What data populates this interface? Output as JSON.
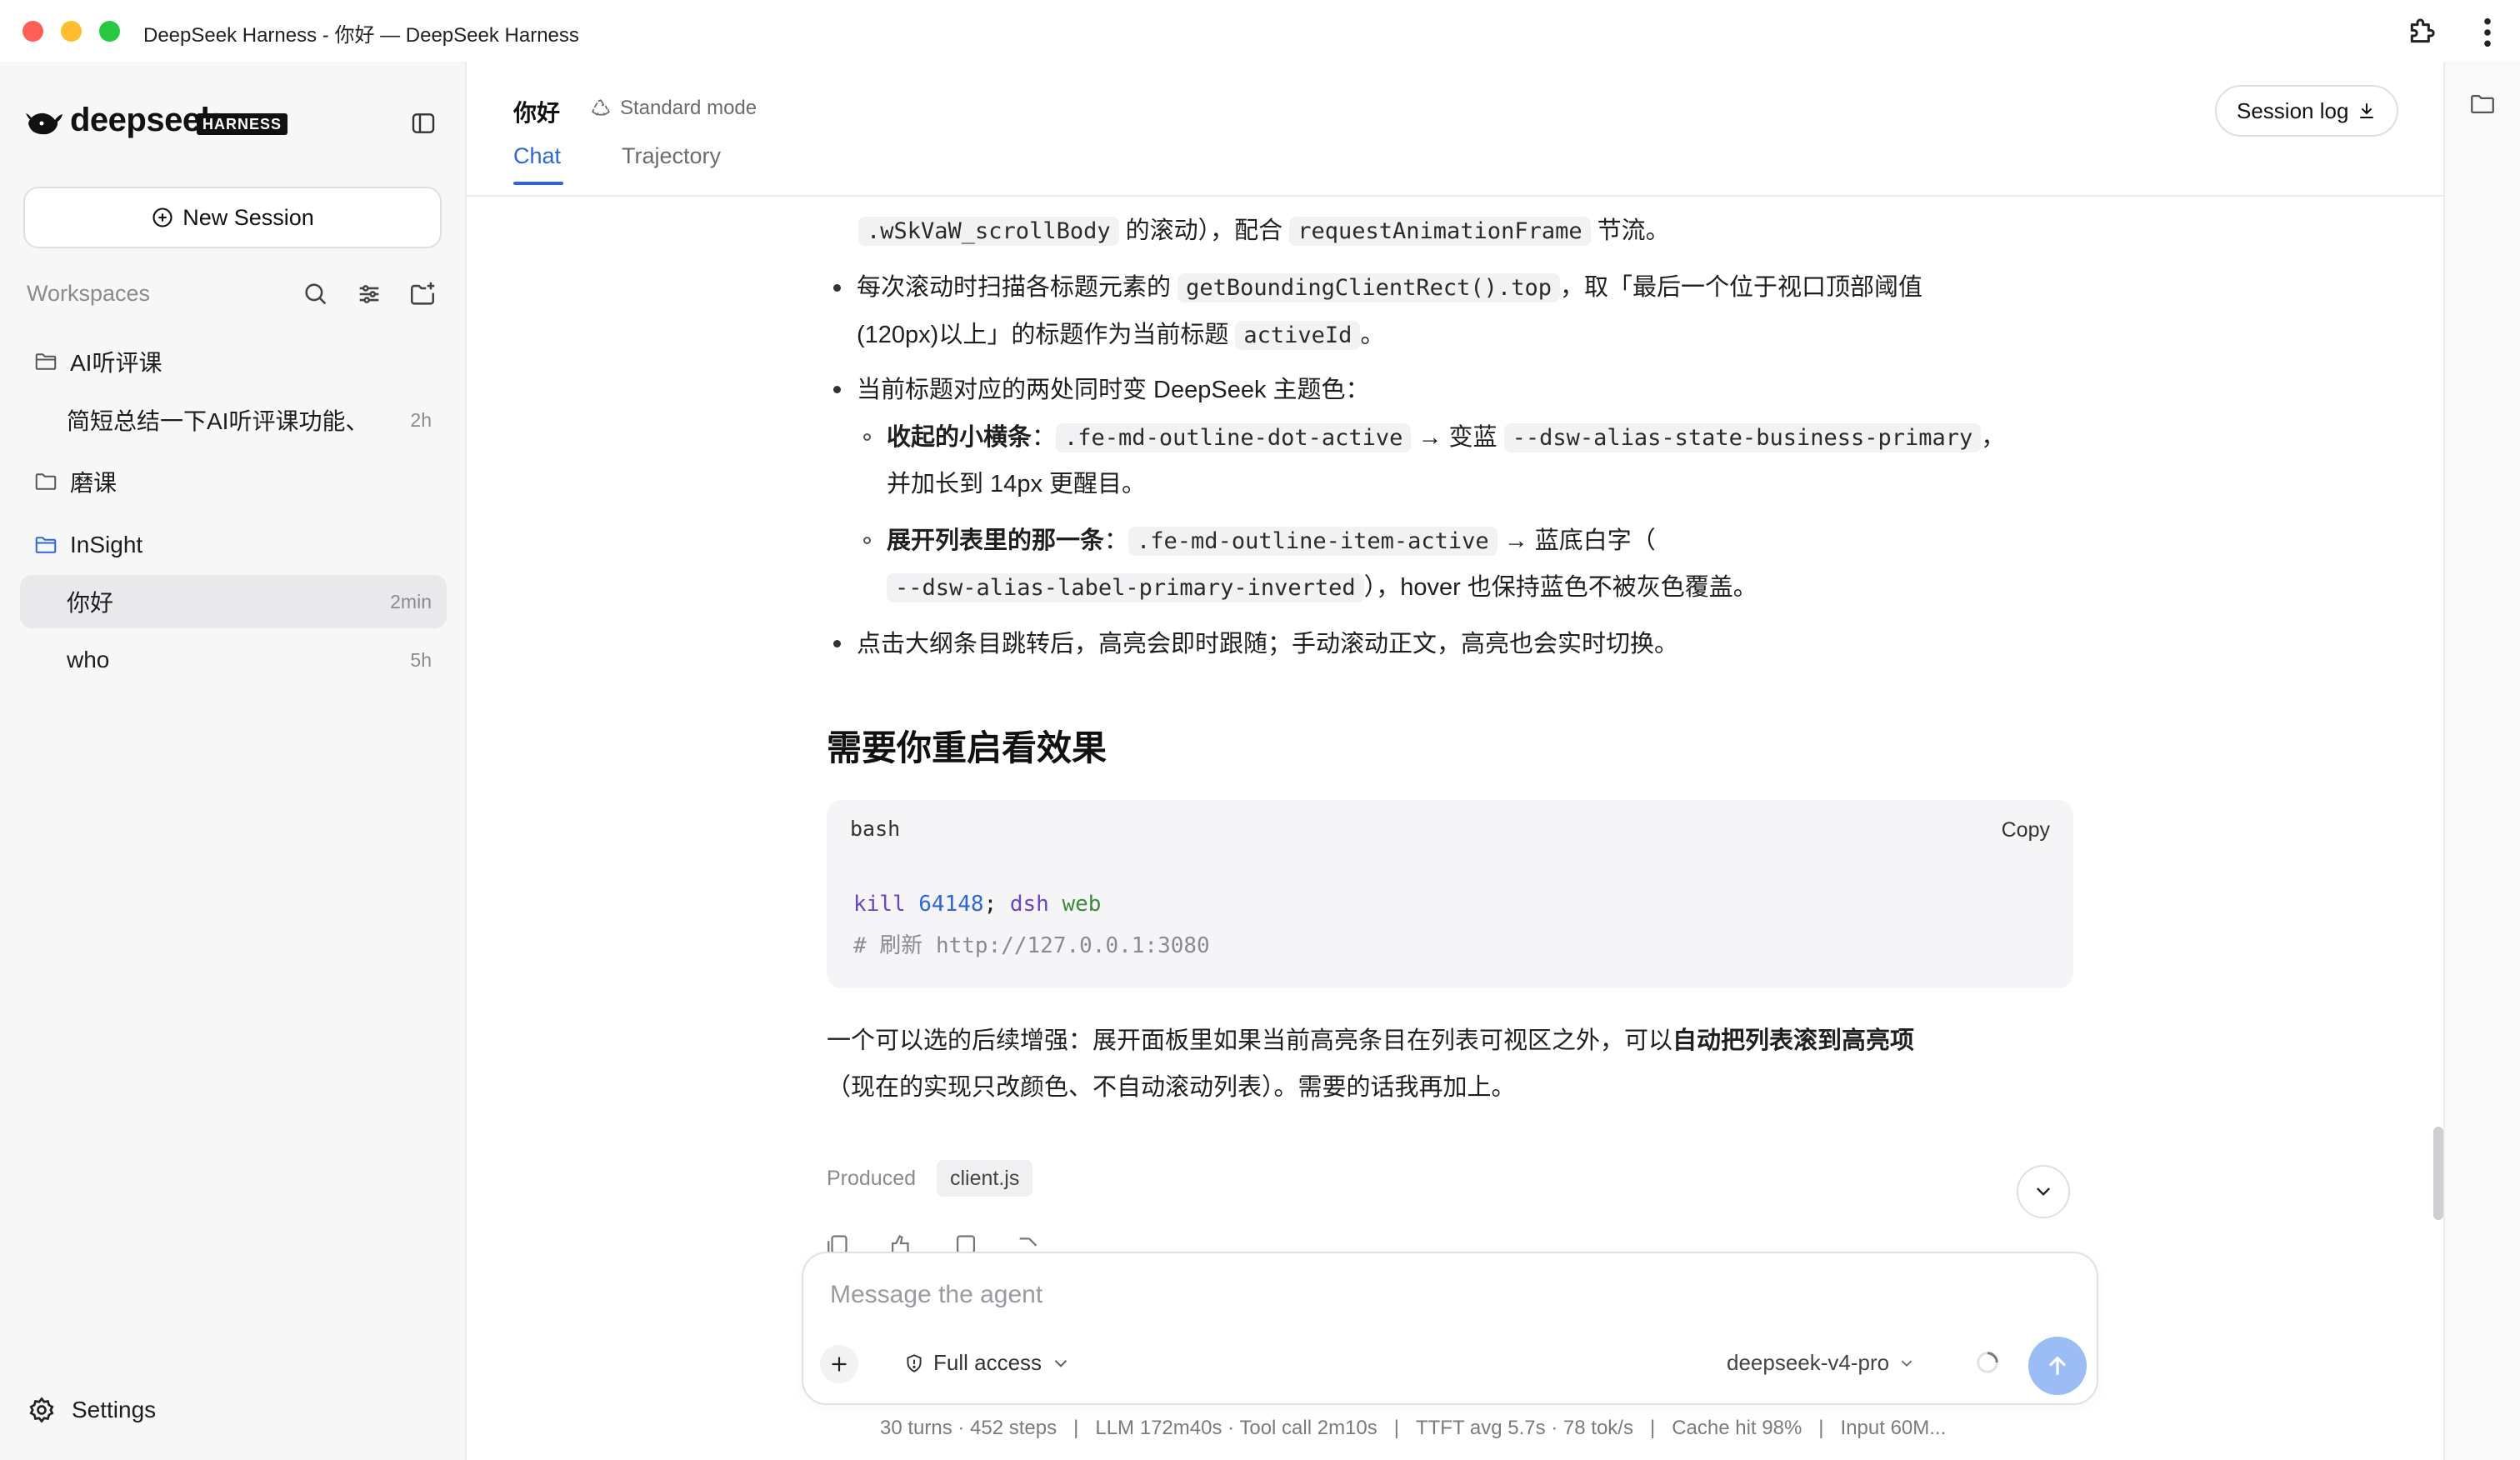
{
  "window": {
    "title": "DeepSeek Harness - 你好 — DeepSeek Harness"
  },
  "sidebar": {
    "logo_text": "deepseek",
    "logo_badge": "HARNESS",
    "new_session_label": "New Session",
    "workspaces_label": "Workspaces",
    "groups": [
      {
        "name": "AI听评课",
        "sessions": [
          {
            "title": "简短总结一下AI听评课功能、",
            "time": "2h"
          }
        ]
      },
      {
        "name": "磨课",
        "sessions": []
      },
      {
        "name": "InSight",
        "sessions": [
          {
            "title": "你好",
            "time": "2min",
            "active": true
          },
          {
            "title": "who",
            "time": "5h"
          }
        ]
      }
    ],
    "settings_label": "Settings"
  },
  "header": {
    "session_title": "你好",
    "mode_label": "Standard mode",
    "tabs": [
      {
        "label": "Chat",
        "active": true
      },
      {
        "label": "Trajectory"
      }
    ],
    "session_log_label": "Session log"
  },
  "message": {
    "l1_code_a": ".wSkVaW_scrollBody",
    "l1_text_a": " 的滚动），配合 ",
    "l1_code_b": "requestAnimationFrame",
    "l1_text_b": " 节流。",
    "b1_text_a": "每次滚动时扫描各标题元素的 ",
    "b1_code_a": "getBoundingClientRect().top",
    "b1_text_b": "，取「最后一个位于视口顶部阈值",
    "b1_text_c": "(120px)以上」的标题作为当前标题 ",
    "b1_code_b": "activeId",
    "b1_text_d": "。",
    "b2_text": "当前标题对应的两处同时变 DeepSeek 主题色：",
    "s1_bold": "收起的小横条",
    "s1_text_a": "：",
    "s1_code_a": ".fe-md-outline-dot-active",
    "s1_text_b": " → 变蓝 ",
    "s1_code_b": "--dsw-alias-state-business-primary",
    "s1_text_c": "，",
    "s1_text_d": "并加长到 14px 更醒目。",
    "s2_bold": "展开列表里的那一条",
    "s2_text_a": "：",
    "s2_code_a": ".fe-md-outline-item-active",
    "s2_text_b": " → 蓝底白字（",
    "s2_code_b": "--dsw-alias-label-primary-inverted",
    "s2_text_c": "），hover 也保持蓝色不被灰色覆盖。",
    "b3_text": "点击大纲条目跳转后，高亮会即时跟随；手动滚动正文，高亮也会实时切换。",
    "heading": "需要你重启看效果",
    "code_lang": "bash",
    "copy_label": "Copy",
    "code_l1_kw1": "kill",
    "code_l1_num": "64148",
    "code_l1_semi": ";",
    "code_l1_kw2": "dsh",
    "code_l1_str": "web",
    "code_l2": "# 刷新 http://127.0.0.1:3080",
    "p_text_a": "一个可以选的后续增强：展开面板里如果当前高亮条目在列表可视区之外，可以",
    "p_bold": "自动把列表滚到高亮项",
    "p_text_b": "（现在的实现只改颜色、不自动滚动列表）。需要的话我再加上。",
    "produced_label": "Produced",
    "produced_file": "client.js"
  },
  "composer": {
    "placeholder": "Message the agent",
    "access_label": "Full access",
    "model_label": "deepseek-v4-pro"
  },
  "status": {
    "turns": "30 turns · 452 steps",
    "timing": "LLM 172m40s · Tool call 2m10s",
    "ttft": "TTFT avg 5.7s · 78 tok/s",
    "cache": "Cache hit 98%",
    "input": "Input 60M..."
  },
  "colors": {
    "accent": "#2e66d8",
    "send_button": "#9bbcf4",
    "sidebar_bg": "#f7f7f8"
  }
}
